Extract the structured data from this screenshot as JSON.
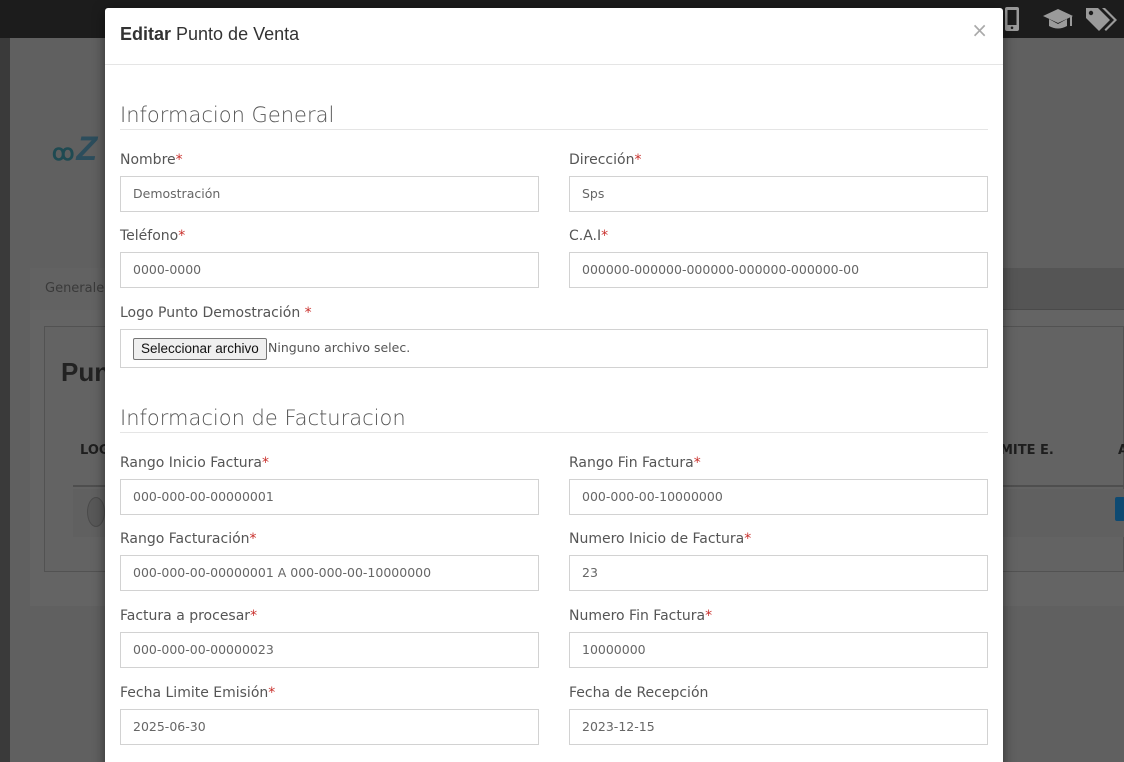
{
  "topbar": {
    "icons": [
      "mobile-icon",
      "graduation-cap-icon",
      "tags-icon"
    ]
  },
  "background": {
    "logo_text": "Z",
    "tab_label": "Generales",
    "card_title": "Punt",
    "table_headers": [
      "LOG",
      "MITE E.",
      "A"
    ]
  },
  "modal": {
    "title_bold": "Editar",
    "title_rest": " Punto de Venta",
    "close": "×",
    "section_general": "Informacion General",
    "section_billing": "Informacion de Facturacion",
    "fields": {
      "nombre": {
        "label": "Nombre",
        "value": "Demostración"
      },
      "direccion": {
        "label": "Dirección",
        "value": "Sps"
      },
      "telefono": {
        "label": "Teléfono",
        "value": "0000-0000"
      },
      "cai": {
        "label": "C.A.I",
        "value": "000000-000000-000000-000000-000000-00"
      },
      "logo": {
        "label": "Logo Punto Demostración ",
        "button": "Seleccionar archivo",
        "file_status": "Ninguno archivo selec."
      },
      "rango_inicio": {
        "label": "Rango Inicio Factura",
        "value": "000-000-00-00000001"
      },
      "rango_fin": {
        "label": "Rango Fin Factura",
        "value": "000-000-00-10000000"
      },
      "rango_facturacion": {
        "label": "Rango Facturación",
        "value": "000-000-00-00000001 A 000-000-00-10000000"
      },
      "numero_inicio": {
        "label": "Numero Inicio de Factura",
        "value": "23"
      },
      "factura_procesar": {
        "label": "Factura a procesar",
        "value": "000-000-00-00000023"
      },
      "numero_fin": {
        "label": "Numero Fin Factura",
        "value": "10000000"
      },
      "fecha_limite": {
        "label": "Fecha Limite Emisión",
        "value": "2025-06-30"
      },
      "fecha_recepcion": {
        "label": "Fecha de Recepción",
        "value": "2023-12-15"
      }
    },
    "required_mark": "*"
  }
}
